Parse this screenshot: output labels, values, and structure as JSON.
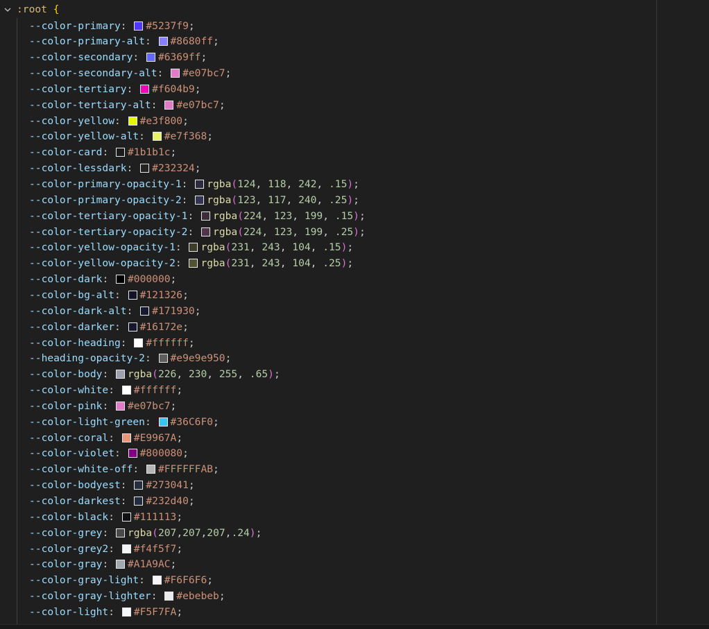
{
  "root": {
    "selector": ":root",
    "brace": "{"
  },
  "fold_icon": "chevron-down-icon",
  "decls": [
    {
      "prop": "--color-primary",
      "swatch": "#5237f9",
      "kind": "hex",
      "value": "#5237f9"
    },
    {
      "prop": "--color-primary-alt",
      "swatch": "#8680ff",
      "kind": "hex",
      "value": "#8680ff"
    },
    {
      "prop": "--color-secondary",
      "swatch": "#6369ff",
      "kind": "hex",
      "value": "#6369ff"
    },
    {
      "prop": "--color-secondary-alt",
      "swatch": "#e07bc7",
      "kind": "hex",
      "value": "#e07bc7"
    },
    {
      "prop": "--color-tertiary",
      "swatch": "#f604b9",
      "kind": "hex",
      "value": "#f604b9"
    },
    {
      "prop": "--color-tertiary-alt",
      "swatch": "#e07bc7",
      "kind": "hex",
      "value": "#e07bc7"
    },
    {
      "prop": "--color-yellow",
      "swatch": "#e3f800",
      "kind": "hex",
      "value": "#e3f800"
    },
    {
      "prop": "--color-yellow-alt",
      "swatch": "#e7f368",
      "kind": "hex",
      "value": "#e7f368"
    },
    {
      "prop": "--color-card",
      "swatch": "#1b1b1c",
      "kind": "hex",
      "value": "#1b1b1c"
    },
    {
      "prop": "--color-lessdark",
      "swatch": "#232324",
      "kind": "hex",
      "value": "#232324"
    },
    {
      "prop": "--color-primary-opacity-1",
      "swatch": "rgba(124,118,242,.15)",
      "kind": "rgba",
      "args": [
        "124",
        "118",
        "242",
        ".15"
      ],
      "sep": ", "
    },
    {
      "prop": "--color-primary-opacity-2",
      "swatch": "rgba(123,117,240,.25)",
      "kind": "rgba",
      "args": [
        "123",
        "117",
        "240",
        ".25"
      ],
      "sep": ", "
    },
    {
      "prop": "--color-tertiary-opacity-1",
      "swatch": "rgba(224,123,199,.15)",
      "kind": "rgba",
      "args": [
        "224",
        "123",
        "199",
        ".15"
      ],
      "sep": ", "
    },
    {
      "prop": "--color-tertiary-opacity-2",
      "swatch": "rgba(224,123,199,.25)",
      "kind": "rgba",
      "args": [
        "224",
        "123",
        "199",
        ".25"
      ],
      "sep": ", "
    },
    {
      "prop": "--color-yellow-opacity-1",
      "swatch": "rgba(231,243,104,.15)",
      "kind": "rgba",
      "args": [
        "231",
        "243",
        "104",
        ".15"
      ],
      "sep": ", "
    },
    {
      "prop": "--color-yellow-opacity-2",
      "swatch": "rgba(231,243,104,.25)",
      "kind": "rgba",
      "args": [
        "231",
        "243",
        "104",
        ".25"
      ],
      "sep": ", "
    },
    {
      "prop": "--color-dark",
      "swatch": "#000000",
      "kind": "hex",
      "value": "#000000"
    },
    {
      "prop": "--color-bg-alt",
      "swatch": "#121326",
      "kind": "hex",
      "value": "#121326"
    },
    {
      "prop": "--color-dark-alt",
      "swatch": "#171930",
      "kind": "hex",
      "value": "#171930"
    },
    {
      "prop": "--color-darker",
      "swatch": "#16172e",
      "kind": "hex",
      "value": "#16172e"
    },
    {
      "prop": "--color-heading",
      "swatch": "#ffffff",
      "kind": "hex",
      "value": "#ffffff"
    },
    {
      "prop": "--heading-opacity-2",
      "swatch": "#e9e9e950",
      "kind": "hex",
      "value": "#e9e9e950"
    },
    {
      "prop": "--color-body",
      "swatch": "rgba(226,230,255,.65)",
      "kind": "rgba",
      "args": [
        "226",
        "230",
        "255",
        ".65"
      ],
      "sep": ", "
    },
    {
      "prop": "--color-white",
      "swatch": "#ffffff",
      "kind": "hex",
      "value": "#ffffff"
    },
    {
      "prop": "--color-pink",
      "swatch": "#e07bc7",
      "kind": "hex",
      "value": "#e07bc7"
    },
    {
      "prop": "--color-light-green",
      "swatch": "#36C6F0",
      "kind": "hex",
      "value": "#36C6F0"
    },
    {
      "prop": "--color-coral",
      "swatch": "#E9967A",
      "kind": "hex",
      "value": "#E9967A"
    },
    {
      "prop": "--color-violet",
      "swatch": "#800080",
      "kind": "hex",
      "value": "#800080"
    },
    {
      "prop": "--color-white-off",
      "swatch": "#FFFFFFAB",
      "kind": "hex",
      "value": "#FFFFFFAB"
    },
    {
      "prop": "--color-bodyest",
      "swatch": "#273041",
      "kind": "hex",
      "value": "#273041"
    },
    {
      "prop": "--color-darkest",
      "swatch": "#232d40",
      "kind": "hex",
      "value": "#232d40"
    },
    {
      "prop": "--color-black",
      "swatch": "#111113",
      "kind": "hex",
      "value": "#111113"
    },
    {
      "prop": "--color-grey",
      "swatch": "rgba(207,207,207,.24)",
      "kind": "rgba",
      "args": [
        "207",
        "207",
        "207",
        ".24"
      ],
      "sep": ","
    },
    {
      "prop": "--color-grey2",
      "swatch": "#f4f5f7",
      "kind": "hex",
      "value": "#f4f5f7"
    },
    {
      "prop": "--color-gray",
      "swatch": "#A1A9AC",
      "kind": "hex",
      "value": "#A1A9AC"
    },
    {
      "prop": "--color-gray-light",
      "swatch": "#F6F6F6",
      "kind": "hex",
      "value": "#F6F6F6"
    },
    {
      "prop": "--color-gray-lighter",
      "swatch": "#ebebeb",
      "kind": "hex",
      "value": "#ebebeb"
    },
    {
      "prop": "--color-light",
      "swatch": "#F5F7FA",
      "kind": "hex",
      "value": "#F5F7FA"
    }
  ]
}
